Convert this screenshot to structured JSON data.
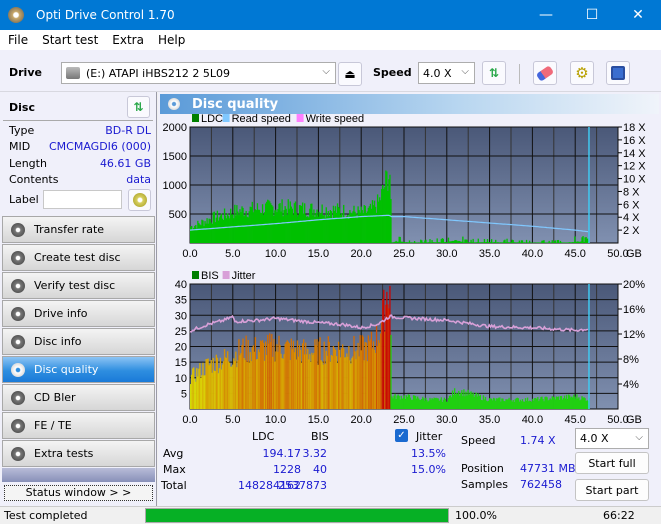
{
  "window": {
    "title": "Opti Drive Control 1.70",
    "minimize": "—",
    "maximize": "☐",
    "close": "✕"
  },
  "menu": [
    "File",
    "Start test",
    "Extra",
    "Help"
  ],
  "toolbar": {
    "drive_label": "Drive",
    "drive_value": "(E:)  ATAPI iHBS212  2 5L09",
    "speed_label": "Speed",
    "speed_value": "4.0 X"
  },
  "disc": {
    "header": "Disc",
    "rows": [
      {
        "key": "Type",
        "value": "BD-R DL"
      },
      {
        "key": "MID",
        "value": "CMCMAGDI6 (000)"
      },
      {
        "key": "Length",
        "value": "46.61 GB"
      },
      {
        "key": "Contents",
        "value": "data"
      }
    ],
    "label_key": "Label",
    "label_value": ""
  },
  "nav": [
    {
      "label": "Transfer rate",
      "active": false
    },
    {
      "label": "Create test disc",
      "active": false
    },
    {
      "label": "Verify test disc",
      "active": false
    },
    {
      "label": "Drive info",
      "active": false
    },
    {
      "label": "Disc info",
      "active": false
    },
    {
      "label": "Disc quality",
      "active": true
    },
    {
      "label": "CD Bler",
      "active": false
    },
    {
      "label": "FE / TE",
      "active": false
    },
    {
      "label": "Extra tests",
      "active": false
    }
  ],
  "status_window_button": "Status window > >",
  "panel_title": "Disc quality",
  "chart_data": [
    {
      "type": "area",
      "title": "",
      "legend": [
        "LDC",
        "Read speed",
        "Write speed"
      ],
      "legend_colors": [
        "#008000",
        "#80c8ff",
        "#ff80ff"
      ],
      "legend_position": "top-left",
      "xlabel": "GB",
      "x_ticks": [
        "0.0",
        "5.0",
        "10.0",
        "15.0",
        "20.0",
        "25.0",
        "30.0",
        "35.0",
        "40.0",
        "45.0",
        "50.0"
      ],
      "xlim": [
        0,
        50
      ],
      "ylim_left": [
        0,
        2000
      ],
      "y_ticks_left": [
        "500",
        "1000",
        "1500",
        "2000"
      ],
      "ylim_right": [
        0,
        18
      ],
      "y_ticks_right": [
        "2 X",
        "4 X",
        "6 X",
        "8 X",
        "10 X",
        "12 X",
        "14 X",
        "16 X",
        "18 X"
      ],
      "grid": true,
      "series": [
        {
          "name": "LDC",
          "x": [
            0,
            1,
            2,
            3,
            4,
            5,
            6,
            8,
            10,
            12,
            14,
            16,
            18,
            20,
            21,
            22,
            22.5,
            23,
            23.3,
            23.5,
            24,
            25,
            26,
            28,
            30,
            31,
            32,
            34,
            36,
            38,
            40,
            42,
            44,
            45.5,
            46.6
          ],
          "values": [
            280,
            330,
            400,
            450,
            480,
            540,
            560,
            590,
            620,
            600,
            580,
            580,
            550,
            520,
            560,
            700,
            900,
            1150,
            1200,
            20,
            150,
            80,
            40,
            60,
            80,
            250,
            50,
            80,
            60,
            60,
            40,
            40,
            50,
            130,
            60
          ]
        },
        {
          "name": "Read speed",
          "x": [
            0,
            5,
            10,
            15,
            20,
            23.3,
            23.5,
            25,
            30,
            35,
            40,
            45,
            46.6
          ],
          "values": [
            2.0,
            2.5,
            3.0,
            3.6,
            4.1,
            4.3,
            4.1,
            4.1,
            3.6,
            3.1,
            2.6,
            2.0,
            1.74
          ]
        }
      ],
      "end_marker_x": 46.61
    },
    {
      "type": "bar",
      "title": "",
      "legend": [
        "BIS",
        "Jitter"
      ],
      "legend_colors": [
        "#008000",
        "#d8a0d8"
      ],
      "legend_position": "top-left",
      "xlabel": "GB",
      "x_ticks": [
        "0.0",
        "5.0",
        "10.0",
        "15.0",
        "20.0",
        "25.0",
        "30.0",
        "35.0",
        "40.0",
        "45.0",
        "50.0"
      ],
      "xlim": [
        0,
        50
      ],
      "ylim_left": [
        0,
        40
      ],
      "y_ticks_left": [
        "5",
        "10",
        "15",
        "20",
        "25",
        "30",
        "35",
        "40"
      ],
      "ylim_right": [
        0,
        20
      ],
      "y_ticks_right": [
        "4%",
        "8%",
        "12%",
        "16%",
        "20%"
      ],
      "grid": true,
      "series": [
        {
          "name": "BIS",
          "x": [
            0,
            1,
            2,
            3,
            4,
            5,
            6,
            8,
            10,
            12,
            14,
            16,
            18,
            20,
            21,
            22,
            22.5,
            23,
            23.3,
            23.5,
            25,
            28,
            30,
            31,
            35,
            40,
            45,
            46.6
          ],
          "values": [
            10,
            12,
            14,
            15,
            16,
            17,
            19,
            19,
            20,
            19,
            18,
            19,
            19,
            19,
            20,
            24,
            30,
            38,
            40,
            4,
            4,
            3,
            3,
            6,
            3,
            3,
            4,
            3
          ]
        },
        {
          "name": "Jitter",
          "x": [
            0,
            2,
            4,
            5,
            5.2,
            8,
            10,
            12,
            15,
            18,
            20,
            22,
            23.3,
            25,
            30,
            35,
            40,
            45,
            46.6
          ],
          "values": [
            12.5,
            13.5,
            14.2,
            14.8,
            14.0,
            14.2,
            14.5,
            14.2,
            13.8,
            13.5,
            13.0,
            13.6,
            14.8,
            14.6,
            14.2,
            13.2,
            13.0,
            12.6,
            12.8
          ]
        }
      ],
      "end_marker_x": 46.61
    }
  ],
  "stats": {
    "col_ldc": "LDC",
    "col_bis": "BIS",
    "rows": [
      {
        "label": "Avg",
        "ldc": "194.17",
        "bis": "3.32",
        "jitter": "13.5%"
      },
      {
        "label": "Max",
        "ldc": "1228",
        "bis": "40",
        "jitter": "15.0%"
      },
      {
        "label": "Total",
        "ldc": "148284162",
        "bis": "2537873"
      }
    ],
    "jitter_label": "Jitter",
    "jitter_checked": true,
    "speed_label": "Speed",
    "speed_value": "1.74 X",
    "position_label": "Position",
    "position_value": "47731 MB",
    "samples_label": "Samples",
    "samples_value": "762458",
    "speed_select": "4.0 X",
    "start_full": "Start full",
    "start_part": "Start part"
  },
  "statusbar": {
    "text": "Test completed",
    "progress": 100.0,
    "progress_text": "100.0%",
    "time": "66:22"
  }
}
